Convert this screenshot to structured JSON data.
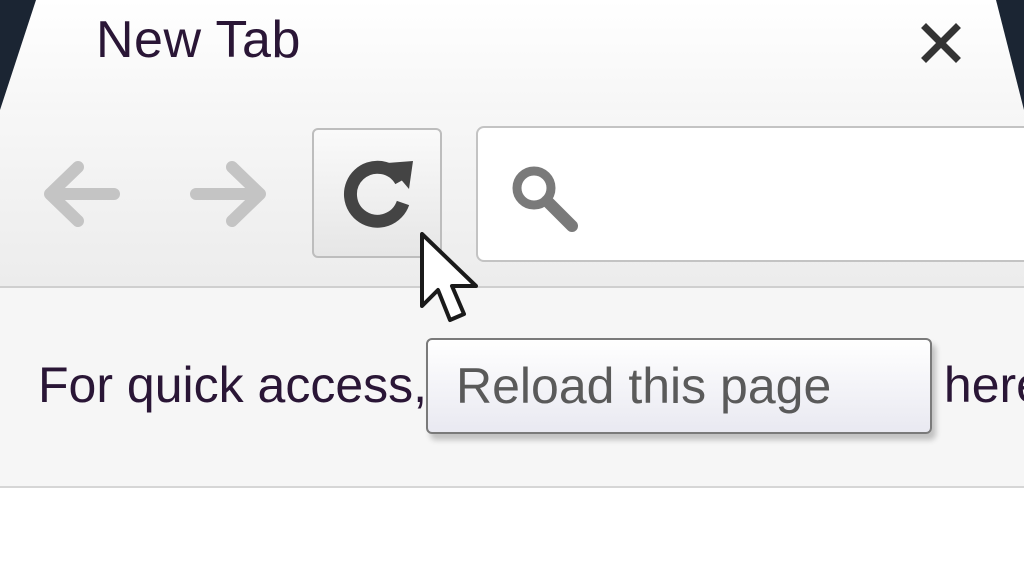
{
  "tab": {
    "title": "New Tab",
    "close_icon": "close-icon"
  },
  "toolbar": {
    "back_icon": "back-arrow-icon",
    "forward_icon": "forward-arrow-icon",
    "reload_icon": "reload-icon",
    "omnibox": {
      "icon": "search-icon",
      "value": ""
    }
  },
  "bookmarks_bar": {
    "message": "For quick access, place your bookmarks here on the bookmarks bar."
  },
  "tooltip": {
    "text": "Reload this page"
  },
  "colors": {
    "frame": "#1b2533",
    "text": "#2a1636",
    "tooltip_text": "#5a5a5a"
  }
}
